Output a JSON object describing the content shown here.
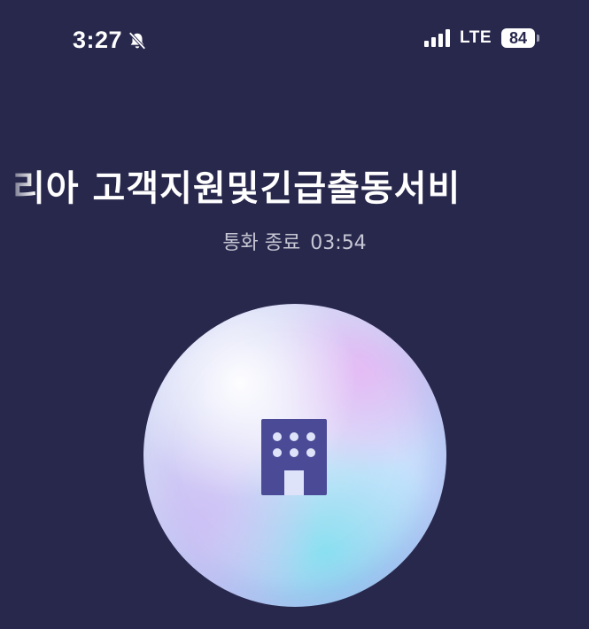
{
  "status_bar": {
    "time": "3:27",
    "network": "LTE",
    "battery_level": "84",
    "icons": [
      "bell-slash-icon",
      "cellular-signal-icon",
      "battery-icon"
    ]
  },
  "call": {
    "caller_name": "리아 고객지원및긴급출동서비",
    "status_label": "통화 종료",
    "duration": "03:54",
    "avatar_icon": "building-icon"
  },
  "colors": {
    "background": "#28284d",
    "icon": "#4a4a96",
    "status_text": "#c6c6d4"
  }
}
